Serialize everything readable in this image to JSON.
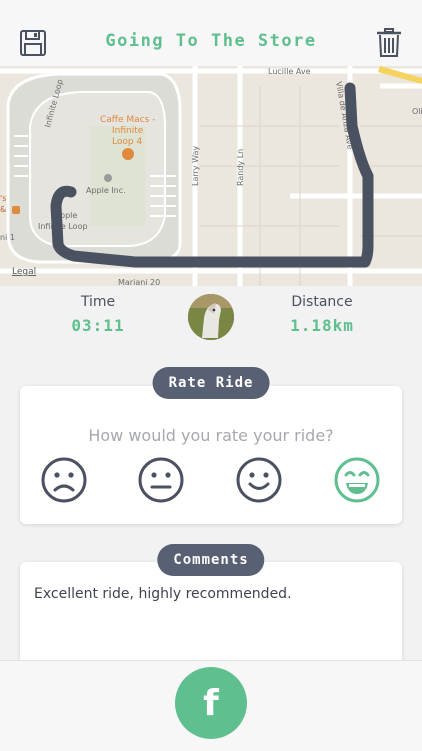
{
  "header": {
    "title": "Going To The Store",
    "left_icon": "save-icon",
    "right_icon": "trash-icon"
  },
  "map": {
    "labels": {
      "street1": "Lucille Ave",
      "street2": "Villa de Anza Ave",
      "street3": "Larry Way",
      "street4": "Randy Ln",
      "cafe": "Caffe Macs -",
      "cafe2": "Infinite",
      "cafe3": "Loop 4",
      "apple": "Apple Inc.",
      "loop_road": "Infinite Loop",
      "apple_loop1": "pple",
      "apple_loop2": "Infinite Loop",
      "legal": "Legal",
      "oli": "Oli",
      "left1": "'s",
      "left2": "&",
      "left3": "ni 1",
      "bottom": "Mariani 20"
    },
    "route_color": "#4a5160"
  },
  "stats": {
    "time_label": "Time",
    "time_value": "03:11",
    "distance_label": "Distance",
    "distance_value": "1.18km"
  },
  "rating": {
    "pill_label": "Rate Ride",
    "question": "How would you rate your ride?",
    "faces": [
      "sad-face-icon",
      "neutral-face-icon",
      "happy-face-icon",
      "very-happy-face-icon"
    ],
    "selected_index": 3,
    "selected_color": "#5fbf8f",
    "unselected_color": "#4a5160"
  },
  "comments": {
    "pill_label": "Comments",
    "text": "Excellent ride, highly recommended."
  },
  "footer": {
    "share_label": "f"
  }
}
